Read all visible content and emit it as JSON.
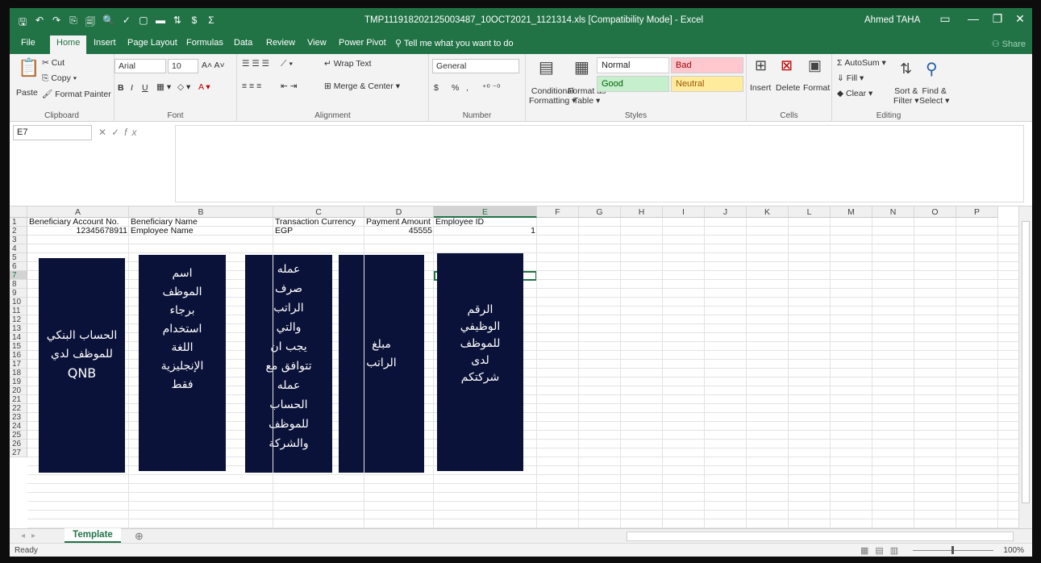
{
  "window": {
    "title": "TMP111918202125003487_10OCT2021_1121314.xls  [Compatibility Mode]  -  Excel",
    "user": "Ahmed TAHA",
    "minimize": "—",
    "restore": "❐",
    "close": "✕"
  },
  "qat": {
    "save": "🖫",
    "undo": "↶",
    "redo": "↷",
    "items": [
      "⎘",
      "🗐",
      "🔍",
      "✓",
      "▢",
      "▬",
      "⇅",
      "$",
      "Σ"
    ]
  },
  "menu": {
    "tabs": [
      "File",
      "Home",
      "Insert",
      "Page Layout",
      "Formulas",
      "Data",
      "Review",
      "View",
      "Power Pivot"
    ],
    "active": "Home",
    "tell_me": "Tell me what you want to do",
    "share": "Share"
  },
  "ribbon": {
    "clipboard": {
      "label": "Clipboard",
      "paste": "Paste",
      "cut": "Cut",
      "copy": "Copy",
      "format_painter": "Format Painter"
    },
    "font": {
      "label": "Font",
      "name": "Arial",
      "size": "10",
      "bold": "B",
      "italic": "I",
      "underline": "U"
    },
    "alignment": {
      "label": "Alignment",
      "wrap_text": "Wrap Text",
      "merge_center": "Merge & Center"
    },
    "number": {
      "label": "Number",
      "format": "General",
      "currency": "$",
      "percent": "%",
      "comma": ","
    },
    "styles": {
      "label": "Styles",
      "conditional": "Conditional",
      "formatting": "Formatting",
      "format_as": "Format as",
      "table": "Table",
      "normal": "Normal",
      "bad": "Bad",
      "good": "Good",
      "neutral": "Neutral",
      "colors": {
        "normal": "#ffffff",
        "bad": "#ffc7ce",
        "good": "#c6efce",
        "neutral": "#ffeb9c",
        "bad_text": "#9c0006",
        "good_text": "#006100",
        "neutral_text": "#9c5700"
      }
    },
    "cells": {
      "label": "Cells",
      "insert": "Insert",
      "delete": "Delete",
      "format": "Format"
    },
    "editing": {
      "label": "Editing",
      "autosum": "AutoSum",
      "fill": "Fill",
      "clear": "Clear",
      "sort": "Sort &",
      "filter": "Filter",
      "find": "Find &",
      "select": "Select"
    }
  },
  "formula_bar": {
    "name_box": "E7",
    "fx": "fx",
    "content": ""
  },
  "grid": {
    "columns": [
      "A",
      "B",
      "C",
      "D",
      "E",
      "F",
      "G",
      "H",
      "I",
      "J",
      "K",
      "L",
      "M",
      "N",
      "O",
      "P"
    ],
    "rows": [
      "1",
      "2",
      "3",
      "4",
      "5",
      "6",
      "7",
      "8",
      "9",
      "10",
      "11",
      "12",
      "13",
      "14",
      "15",
      "16",
      "17",
      "18",
      "19",
      "20",
      "21",
      "22",
      "23",
      "24",
      "25",
      "26",
      "27"
    ],
    "selected_cell": "E7",
    "header_row": [
      "Beneficiary Account No.",
      "Beneficiary Name",
      "Transaction Currency",
      "Payment Amount",
      "Employee ID"
    ],
    "data_row": [
      "12345678911",
      "Employee Name",
      "EGP",
      "45555",
      "1"
    ]
  },
  "annotations": [
    {
      "lines": [
        "الحساب البنكي",
        "للموظف لدي",
        "QNB"
      ]
    },
    {
      "lines": [
        "اسم",
        "الموظف",
        "برجاء",
        "استخدام",
        "اللغة",
        "الإنجليزية",
        "فقط"
      ]
    },
    {
      "lines": [
        "عمله",
        "صرف",
        "الراتب",
        "والتي",
        "يجب ان",
        "تتوافق مع",
        "عمله",
        "الحساب",
        "للموظف",
        "والشركة"
      ]
    },
    {
      "lines": [
        "مبلغ",
        "الراتب"
      ]
    },
    {
      "lines": [
        "الرقم",
        "الوظيفي",
        "للموظف",
        "لدى",
        "شركتكم"
      ]
    }
  ],
  "sheets": {
    "active": "Template",
    "add": "⊕"
  },
  "status": {
    "ready": "Ready",
    "zoom": "100%"
  },
  "colors": {
    "excel_green": "#217346",
    "annotation_bg": "#0b1239"
  }
}
